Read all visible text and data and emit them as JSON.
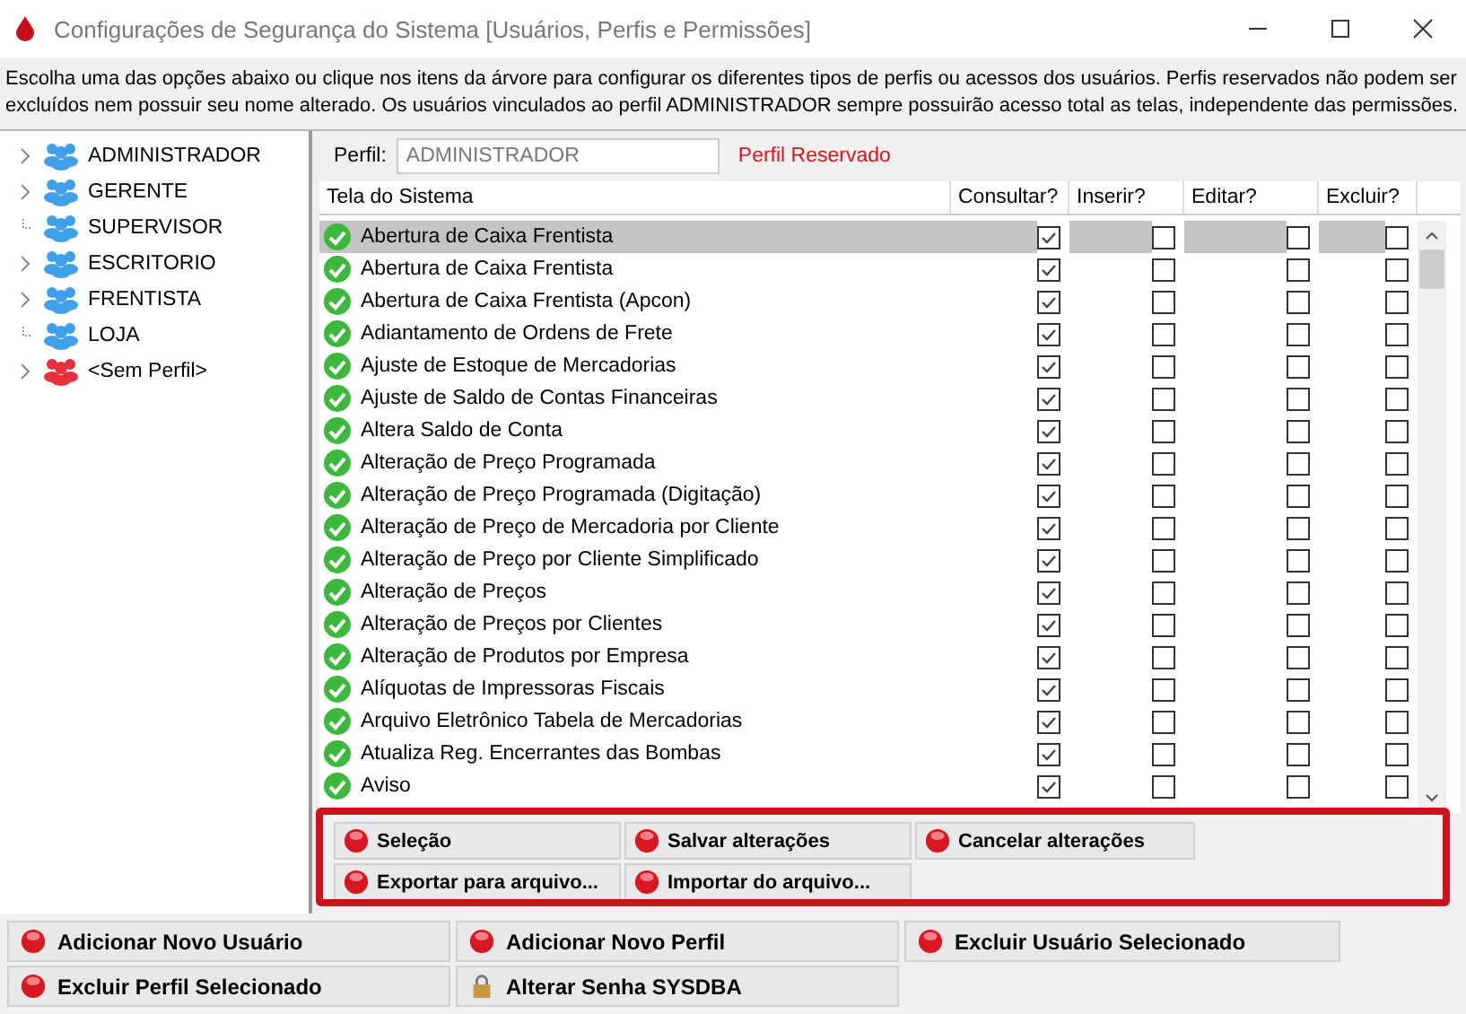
{
  "window": {
    "title": "Configurações de Segurança do Sistema [Usuários, Perfis e Permissões]"
  },
  "description": "Escolha uma das opções abaixo ou clique nos itens da árvore para configurar os diferentes tipos de perfis ou acessos dos usuários. Perfis reservados não podem ser excluídos nem possuir seu nome alterado. Os usuários vinculados ao perfil ADMINISTRADOR sempre possuirão acesso total as telas, independente das permissões.",
  "tree": [
    {
      "label": "ADMINISTRADOR",
      "expandable": true,
      "color": "#3f9fe8"
    },
    {
      "label": "GERENTE",
      "expandable": true,
      "color": "#3f9fe8"
    },
    {
      "label": "SUPERVISOR",
      "expandable": false,
      "color": "#3f9fe8"
    },
    {
      "label": "ESCRITORIO",
      "expandable": true,
      "color": "#3f9fe8"
    },
    {
      "label": "FRENTISTA",
      "expandable": true,
      "color": "#3f9fe8"
    },
    {
      "label": "LOJA",
      "expandable": false,
      "color": "#3f9fe8"
    },
    {
      "label": "<Sem Perfil>",
      "expandable": true,
      "color": "#e8303a"
    }
  ],
  "profile": {
    "label": "Perfil:",
    "value": "ADMINISTRADOR",
    "note": "Perfil Reservado"
  },
  "table": {
    "columns": [
      "Tela do Sistema",
      "Consultar?",
      "Inserir?",
      "Editar?",
      "Excluir?"
    ],
    "rows": [
      {
        "name": "Abertura de Caixa Frentista",
        "selected": true,
        "consultar": true,
        "inserir": false,
        "editar": false,
        "excluir": false
      },
      {
        "name": "Abertura de Caixa Frentista",
        "selected": false,
        "consultar": true,
        "inserir": false,
        "editar": false,
        "excluir": false
      },
      {
        "name": "Abertura de Caixa Frentista (Apcon)",
        "selected": false,
        "consultar": true,
        "inserir": false,
        "editar": false,
        "excluir": false
      },
      {
        "name": "Adiantamento de Ordens de Frete",
        "selected": false,
        "consultar": true,
        "inserir": false,
        "editar": false,
        "excluir": false
      },
      {
        "name": "Ajuste de Estoque de Mercadorias",
        "selected": false,
        "consultar": true,
        "inserir": false,
        "editar": false,
        "excluir": false
      },
      {
        "name": "Ajuste de Saldo de Contas Financeiras",
        "selected": false,
        "consultar": true,
        "inserir": false,
        "editar": false,
        "excluir": false
      },
      {
        "name": "Altera Saldo de Conta",
        "selected": false,
        "consultar": true,
        "inserir": false,
        "editar": false,
        "excluir": false
      },
      {
        "name": "Alteração de Preço Programada",
        "selected": false,
        "consultar": true,
        "inserir": false,
        "editar": false,
        "excluir": false
      },
      {
        "name": "Alteração de Preço Programada (Digitação)",
        "selected": false,
        "consultar": true,
        "inserir": false,
        "editar": false,
        "excluir": false
      },
      {
        "name": "Alteração de Preço de Mercadoria por Cliente",
        "selected": false,
        "consultar": true,
        "inserir": false,
        "editar": false,
        "excluir": false
      },
      {
        "name": "Alteração de Preço por Cliente Simplificado",
        "selected": false,
        "consultar": true,
        "inserir": false,
        "editar": false,
        "excluir": false
      },
      {
        "name": "Alteração de Preços",
        "selected": false,
        "consultar": true,
        "inserir": false,
        "editar": false,
        "excluir": false
      },
      {
        "name": "Alteração de Preços por Clientes",
        "selected": false,
        "consultar": true,
        "inserir": false,
        "editar": false,
        "excluir": false
      },
      {
        "name": "Alteração de Produtos por Empresa",
        "selected": false,
        "consultar": true,
        "inserir": false,
        "editar": false,
        "excluir": false
      },
      {
        "name": "Alíquotas de Impressoras Fiscais",
        "selected": false,
        "consultar": true,
        "inserir": false,
        "editar": false,
        "excluir": false
      },
      {
        "name": "Arquivo Eletrônico Tabela de Mercadorias",
        "selected": false,
        "consultar": true,
        "inserir": false,
        "editar": false,
        "excluir": false
      },
      {
        "name": "Atualiza Reg. Encerrantes das Bombas",
        "selected": false,
        "consultar": true,
        "inserir": false,
        "editar": false,
        "excluir": false
      },
      {
        "name": "Aviso",
        "selected": false,
        "consultar": true,
        "inserir": false,
        "editar": false,
        "excluir": false
      }
    ]
  },
  "panel_buttons": [
    {
      "label": "Seleção",
      "kind": "lamp"
    },
    {
      "label": "Salvar alterações",
      "kind": "lamp"
    },
    {
      "label": "Cancelar alterações",
      "kind": "lamp"
    },
    {
      "label": "Exportar para arquivo...",
      "kind": "lamp"
    },
    {
      "label": "Importar do arquivo...",
      "kind": "lamp"
    }
  ],
  "bottom_buttons": [
    {
      "label": "Adicionar Novo Usuário",
      "kind": "lamp"
    },
    {
      "label": "Adicionar Novo Perfil",
      "kind": "lamp"
    },
    {
      "label": "Excluir Usuário Selecionado",
      "kind": "lamp"
    },
    {
      "label": "Excluir Perfil Selecionado",
      "kind": "lamp"
    },
    {
      "label": "Alterar Senha SYSDBA",
      "kind": "lock"
    }
  ]
}
